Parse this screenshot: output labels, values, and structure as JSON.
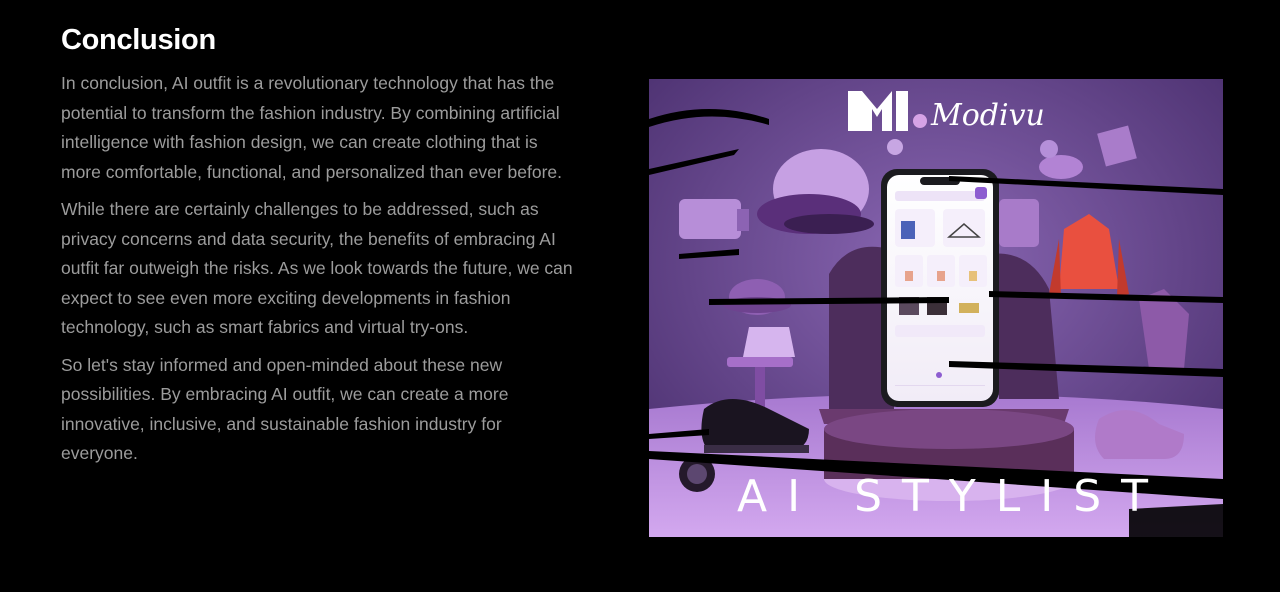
{
  "conclusion": {
    "heading": "Conclusion",
    "paragraphs": [
      "In conclusion, AI outfit is a revolutionary technology that has the potential to transform the fashion industry. By combining artificial intelligence with fashion design, we can create clothing that is more comfortable, functional, and personalized than ever before.",
      "While there are certainly challenges to be addressed, such as privacy concerns and data security, the benefits of embracing AI outfit far outweigh the risks. As we look towards the future, we can expect to see even more exciting developments in fashion technology, such as smart fabrics and virtual try-ons.",
      "So let's stay informed and open-minded about these new possibilities. By embracing AI outfit, we can create a more innovative, inclusive, and sustainable fashion industry for everyone."
    ]
  },
  "promo_image": {
    "logo_mark": "M1",
    "logo_brand": "Modivu",
    "banner_text": "AI STYLIST",
    "colors": {
      "background": "#6b4a93",
      "floor": "#c59ae3",
      "accent_jacket": "#e9503f",
      "pedestal": "#5a2f5a"
    }
  }
}
